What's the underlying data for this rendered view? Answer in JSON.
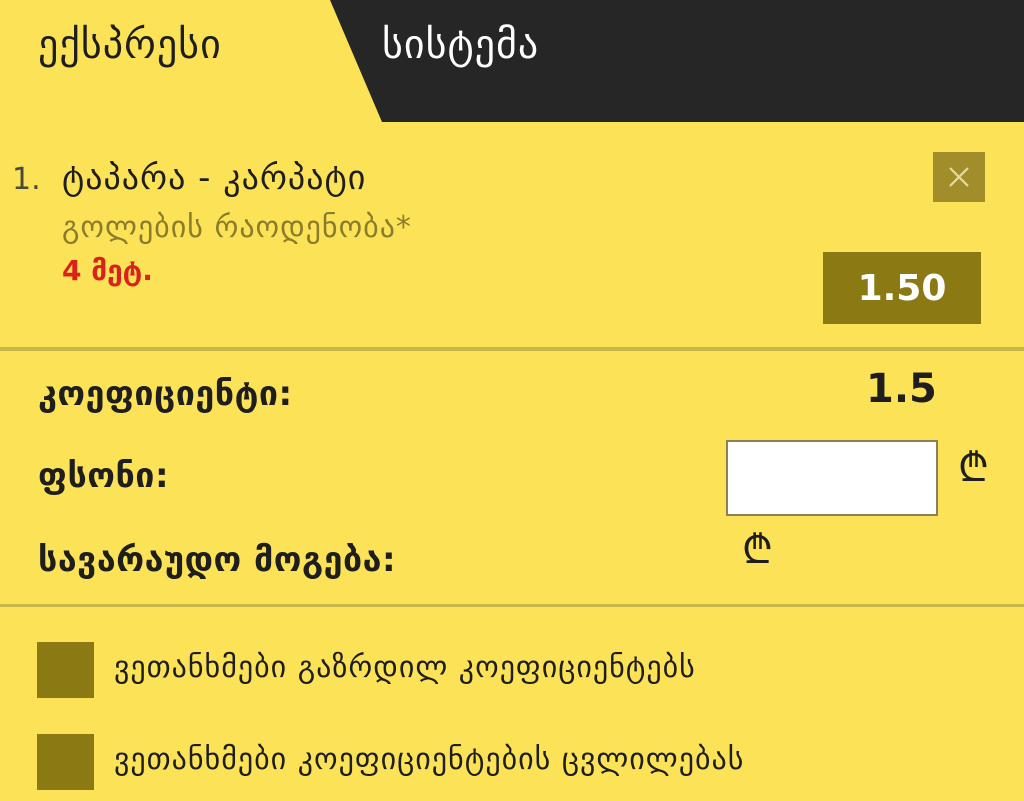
{
  "tabs": [
    {
      "label": "ექსპრესი",
      "active": true
    },
    {
      "label": "სისტემა",
      "active": false
    }
  ],
  "selection": {
    "index": "1.",
    "match": "ტაპარა - კარპატი",
    "market": "გოლების რაოდენობა*",
    "outcome": "4 მეტ.",
    "odds": "1.50"
  },
  "totals": {
    "coefficient_label": "კოეფიციენტი:",
    "coefficient_value": "1.5",
    "stake_label": "ფსონი:",
    "stake_value": "",
    "potential_win_label": "სავარაუდო მოგება:",
    "currency_symbol": "₾"
  },
  "options": [
    {
      "label": "ვეთანხმები გაზრდილ კოეფიციენტებს",
      "checked": false
    },
    {
      "label": "ვეთანხმები კოეფიციენტების ცვლილებას",
      "checked": false
    }
  ],
  "colors": {
    "background": "#fce257",
    "dark_tab": "#262626",
    "accent_olive": "#8b7a14",
    "outcome_red": "#d8231c"
  }
}
